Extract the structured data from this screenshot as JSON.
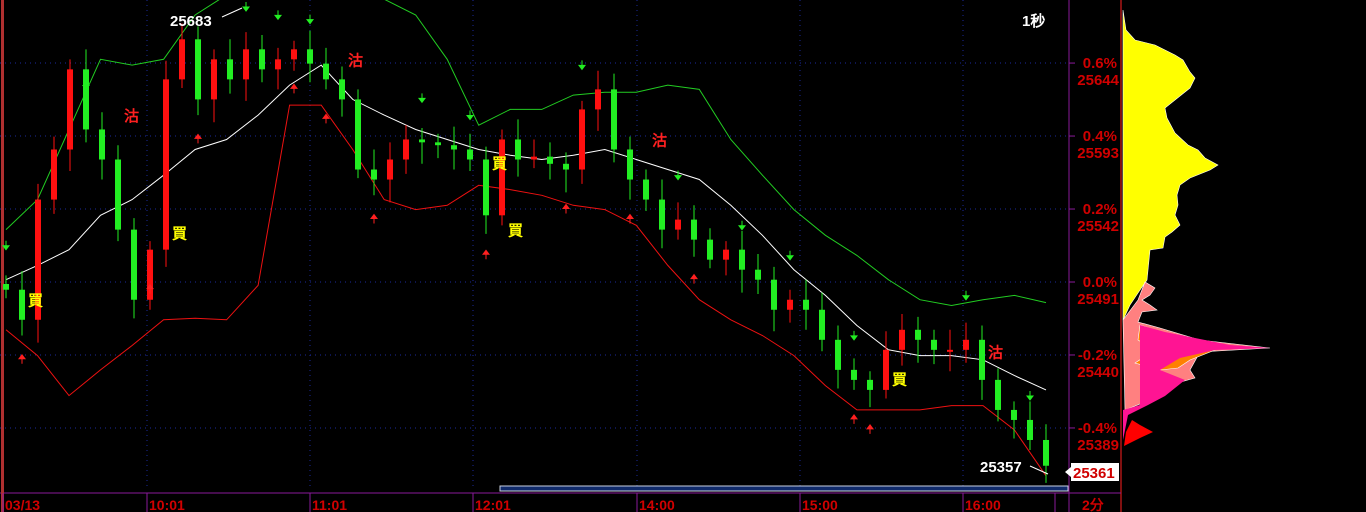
{
  "chart_data": {
    "type": "candlestick",
    "interval_label": "1秒",
    "bottom_right_label": "2分",
    "x_ticks": [
      "03/13",
      "10:01",
      "11:01",
      "12:01",
      "14:00",
      "15:00",
      "16:00"
    ],
    "y_ticks": [
      {
        "pct": "0.6%",
        "price": "25644",
        "value": 25644
      },
      {
        "pct": "0.4%",
        "price": "25593",
        "value": 25593
      },
      {
        "pct": "0.2%",
        "price": "25542",
        "value": 25542
      },
      {
        "pct": "0.0%",
        "price": "25491",
        "value": 25491
      },
      {
        "pct": "-0.2%",
        "price": "25440",
        "value": 25440
      },
      {
        "pct": "-0.4%",
        "price": "25389",
        "value": 25389
      }
    ],
    "reference_price": 25491,
    "last_price": "25361",
    "high_label": "25683",
    "low_label": "25357",
    "closes": [
      25487,
      25466,
      25550,
      25585,
      25641,
      25599,
      25578,
      25529,
      25480,
      25515,
      25634,
      25662,
      25620,
      25648,
      25634,
      25655,
      25641,
      25648,
      25655,
      25645,
      25634,
      25620,
      25571,
      25564,
      25578,
      25592,
      25590,
      25588,
      25585,
      25578,
      25539,
      25592,
      25578,
      25580,
      25575,
      25571,
      25613,
      25627,
      25585,
      25564,
      25550,
      25529,
      25536,
      25522,
      25508,
      25515,
      25501,
      25494,
      25473,
      25480,
      25473,
      25452,
      25431,
      25424,
      25417,
      25445,
      25459,
      25452,
      25445,
      25445,
      25452,
      25424,
      25403,
      25396,
      25382,
      25364
    ],
    "bollinger": {
      "middle": [
        25494,
        25504,
        25515,
        25539,
        25550,
        25567,
        25585,
        25592,
        25609,
        25630,
        25644,
        25620,
        25609,
        25599,
        25592,
        25585,
        25581,
        25578,
        25581,
        25585,
        25578,
        25571,
        25564,
        25546,
        25525,
        25501,
        25483,
        25462,
        25445,
        25441,
        25441,
        25438,
        25427,
        25417
      ],
      "upper": [
        25529,
        25550,
        25599,
        25648,
        25644,
        25648,
        25679,
        25693,
        25703,
        25703,
        25700,
        25693,
        25690,
        25679,
        25648,
        25602,
        25613,
        25613,
        25623,
        25625,
        25625,
        25630,
        25627,
        25592,
        25567,
        25543,
        25525,
        25511,
        25494,
        25480,
        25476,
        25480,
        25483,
        25478
      ],
      "lower": [
        25459,
        25441,
        25413,
        25431,
        25448,
        25466,
        25467,
        25466,
        25490,
        25616,
        25616,
        25585,
        25550,
        25543,
        25546,
        25560,
        25557,
        25553,
        25546,
        25543,
        25532,
        25504,
        25480,
        25466,
        25455,
        25441,
        25420,
        25403,
        25403,
        25403,
        25406,
        25406,
        25389,
        25357
      ]
    },
    "signals": [
      {
        "label": "買",
        "kind": "buy",
        "index": 1,
        "price": 25480
      },
      {
        "label": "買",
        "kind": "buy",
        "index": 10,
        "price": 25527
      },
      {
        "label": "買",
        "kind": "buy",
        "index": 31,
        "price": 25529
      },
      {
        "label": "買",
        "kind": "buy",
        "index": 30,
        "price": 25576
      },
      {
        "label": "買",
        "kind": "buy",
        "index": 55,
        "price": 25425
      },
      {
        "label": "沽",
        "kind": "sell",
        "index": 7,
        "price": 25609
      },
      {
        "label": "沽",
        "kind": "sell",
        "index": 21,
        "price": 25648
      },
      {
        "label": "沽",
        "kind": "sell",
        "index": 40,
        "price": 25592
      },
      {
        "label": "沽",
        "kind": "sell",
        "index": 61,
        "price": 25444
      }
    ],
    "up_arrows": [
      1,
      9,
      12,
      18,
      20,
      23,
      30,
      35,
      39,
      43,
      53,
      54
    ],
    "down_arrows": [
      0,
      5,
      15,
      17,
      19,
      26,
      29,
      36,
      42,
      46,
      49,
      53,
      60,
      64
    ]
  }
}
